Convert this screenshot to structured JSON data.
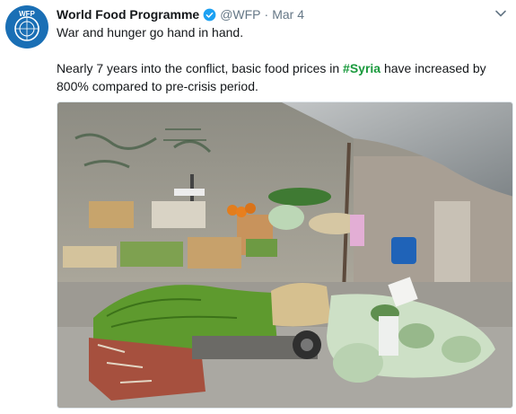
{
  "account": {
    "avatar_text": "WFP",
    "display_name": "World Food Programme",
    "verified_icon": "verified-badge-icon",
    "handle": "@WFP",
    "separator": "·",
    "date": "Mar 4",
    "menu_icon": "chevron-down-icon"
  },
  "tweet": {
    "line1": "War and hunger go hand in hand.",
    "line2_part1": "Nearly 7 years into the conflict, basic food prices in ",
    "hashtag": "#Syria",
    "line2_part2": " have increased by 800% compared to pre-crisis period."
  },
  "colors": {
    "avatar": "#1a6fb5",
    "hashtag": "#1a9a3d",
    "verified": "#1da1f2",
    "muted": "#657786"
  }
}
